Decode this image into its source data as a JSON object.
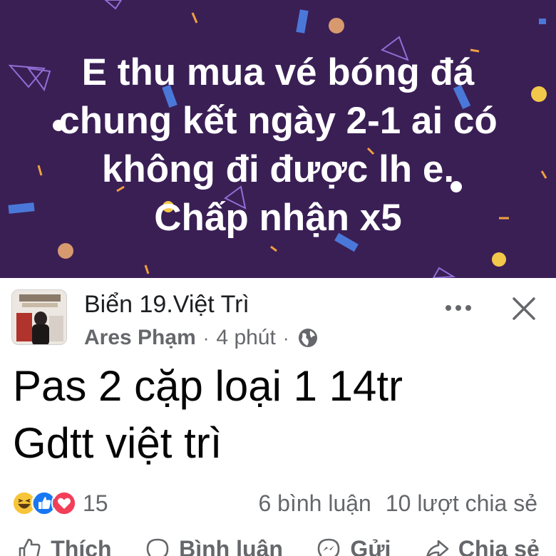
{
  "banner": {
    "lines": [
      "E thu mua vé bóng đá",
      "chung kết ngày 2-1 ai có",
      "không đi được lh e.",
      "Chấp nhận x5"
    ],
    "background_color": "#3a1f55"
  },
  "post": {
    "group_name": "Biển 19.Việt Trì",
    "author": "Ares Phạm",
    "time": "4 phút",
    "separator": "·",
    "text_lines": [
      "Pas 2 cặp loại 1 14tr",
      "Gdtt việt trì"
    ],
    "icons": {
      "privacy": "globe-icon",
      "more": "more-options-icon",
      "close": "close-icon"
    }
  },
  "stats": {
    "reaction_count": "15",
    "comments": "6 bình luận",
    "shares": "10 lượt chia sẻ",
    "reaction_icons": [
      "haha-icon",
      "like-icon",
      "love-icon"
    ]
  },
  "actions": {
    "like": "Thích",
    "comment": "Bình luận",
    "send": "Gửi",
    "share": "Chia sẻ"
  }
}
